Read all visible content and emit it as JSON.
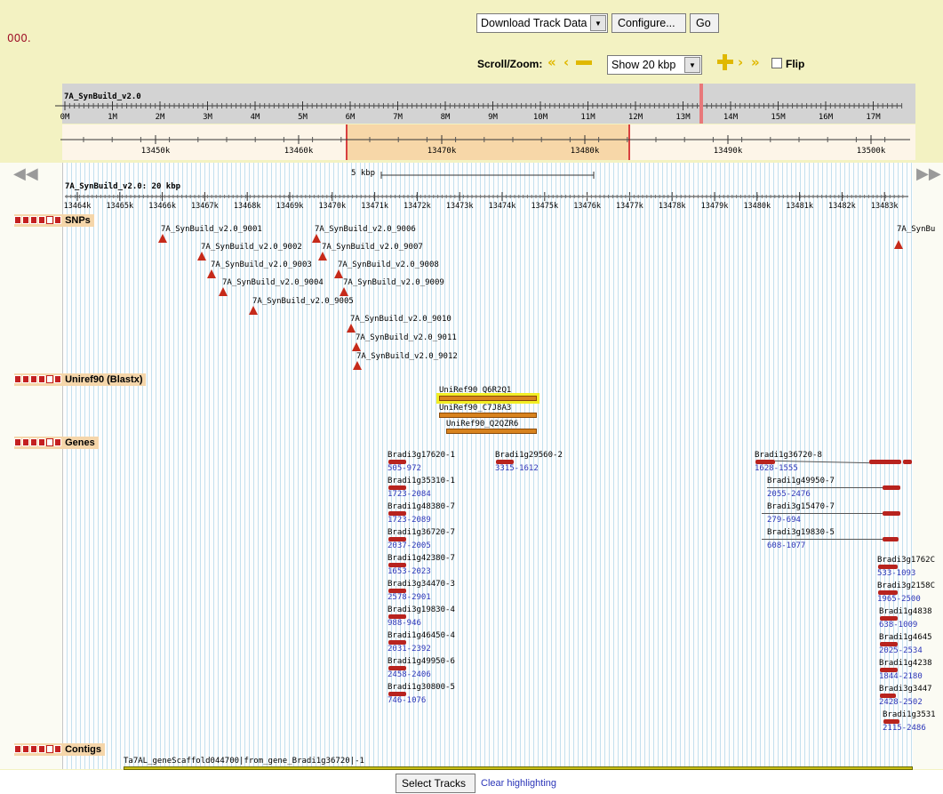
{
  "toolbar": {
    "left_text": "000.",
    "download_select": "Download Track Data",
    "configure_label": "Configure...",
    "go_label": "Go",
    "scroll_zoom_label": "Scroll/Zoom:",
    "zoom_select": "Show 20 kbp",
    "flip_label": "Flip"
  },
  "overview": {
    "chrom_name": "7A_SynBuild_v2.0",
    "ticks": [
      "0M",
      "1M",
      "2M",
      "3M",
      "4M",
      "5M",
      "6M",
      "7M",
      "8M",
      "9M",
      "10M",
      "11M",
      "12M",
      "13M",
      "14M",
      "15M",
      "16M",
      "17M"
    ],
    "highlight_color": "#e8787a"
  },
  "region": {
    "ticks": [
      "13450k",
      "13460k",
      "13470k",
      "13480k",
      "13490k",
      "13500k"
    ]
  },
  "detail": {
    "scale_label": "5 kbp",
    "title": "7A_SynBuild_v2.0: 20 kbp",
    "ticks": [
      "13464k",
      "13465k",
      "13466k",
      "13467k",
      "13468k",
      "13469k",
      "13470k",
      "13471k",
      "13472k",
      "13473k",
      "13474k",
      "13475k",
      "13476k",
      "13477k",
      "13478k",
      "13479k",
      "13480k",
      "13481k",
      "13482k",
      "13483k"
    ]
  },
  "tracks": {
    "snps": {
      "label": "SNPs",
      "items": [
        "7A_SynBuild_v2.0_9001",
        "7A_SynBuild_v2.0_9002",
        "7A_SynBuild_v2.0_9003",
        "7A_SynBuild_v2.0_9004",
        "7A_SynBuild_v2.0_9005",
        "7A_SynBuild_v2.0_9006",
        "7A_SynBuild_v2.0_9007",
        "7A_SynBuild_v2.0_9008",
        "7A_SynBuild_v2.0_9009",
        "7A_SynBuild_v2.0_9010",
        "7A_SynBuild_v2.0_9011",
        "7A_SynBuild_v2.0_9012",
        "7A_SynBu"
      ]
    },
    "uniref": {
      "label": "Uniref90 (Blastx)",
      "items": [
        "UniRef90_Q6R2Q1",
        "UniRef90_C7J8A3",
        "UniRef90_Q2QZR6"
      ]
    },
    "genes": {
      "label": "Genes",
      "col1": [
        {
          "name": "Bradi3g17620-1",
          "range": "505-972"
        },
        {
          "name": "Bradi1g35310-1",
          "range": "1723-2084"
        },
        {
          "name": "Bradi1g48380-7",
          "range": "1723-2089"
        },
        {
          "name": "Bradi1g36720-7",
          "range": "2037-2005"
        },
        {
          "name": "Bradi1g42380-7",
          "range": "1653-2023"
        },
        {
          "name": "Bradi3g34470-3",
          "range": "2578-2901"
        },
        {
          "name": "Bradi3g19830-4",
          "range": "988-946"
        },
        {
          "name": "Bradi1g46450-4",
          "range": "2031-2392"
        },
        {
          "name": "Bradi1g49950-6",
          "range": "2458-2406"
        },
        {
          "name": "Bradi1g30800-5",
          "range": "746-1076"
        }
      ],
      "col2": [
        {
          "name": "Bradi1g29560-2",
          "range": "3315-1612"
        }
      ],
      "col3": [
        {
          "name": "Bradi1g36720-8",
          "range": "1628-1555"
        },
        {
          "name": "Bradi1g49950-7",
          "range": "2055-2476"
        },
        {
          "name": "Bradi3g15470-7",
          "range": "279-694"
        },
        {
          "name": "Bradi3g19830-5",
          "range": "608-1077"
        }
      ],
      "col4": [
        {
          "name": "Bradi3g1762C",
          "range": "533-1093"
        },
        {
          "name": "Bradi3g2158C",
          "range": "1965-2500"
        },
        {
          "name": "Bradi1g4838",
          "range": "638-1009"
        },
        {
          "name": "Bradi1g4645",
          "range": "2025-2534"
        },
        {
          "name": "Bradi1g4238",
          "range": "1844-2180"
        },
        {
          "name": "Bradi3g3447",
          "range": "2428-2502"
        },
        {
          "name": "Bradi1g3531",
          "range": "2115-2486"
        }
      ]
    },
    "contigs": {
      "label": "Contigs",
      "item": "Ta7AL_geneScaffold044700|from_gene_Bradi1g36720|-1"
    }
  },
  "bottom": {
    "select_tracks_label": "Select Tracks",
    "clear_highlight_label": "Clear highlighting"
  }
}
